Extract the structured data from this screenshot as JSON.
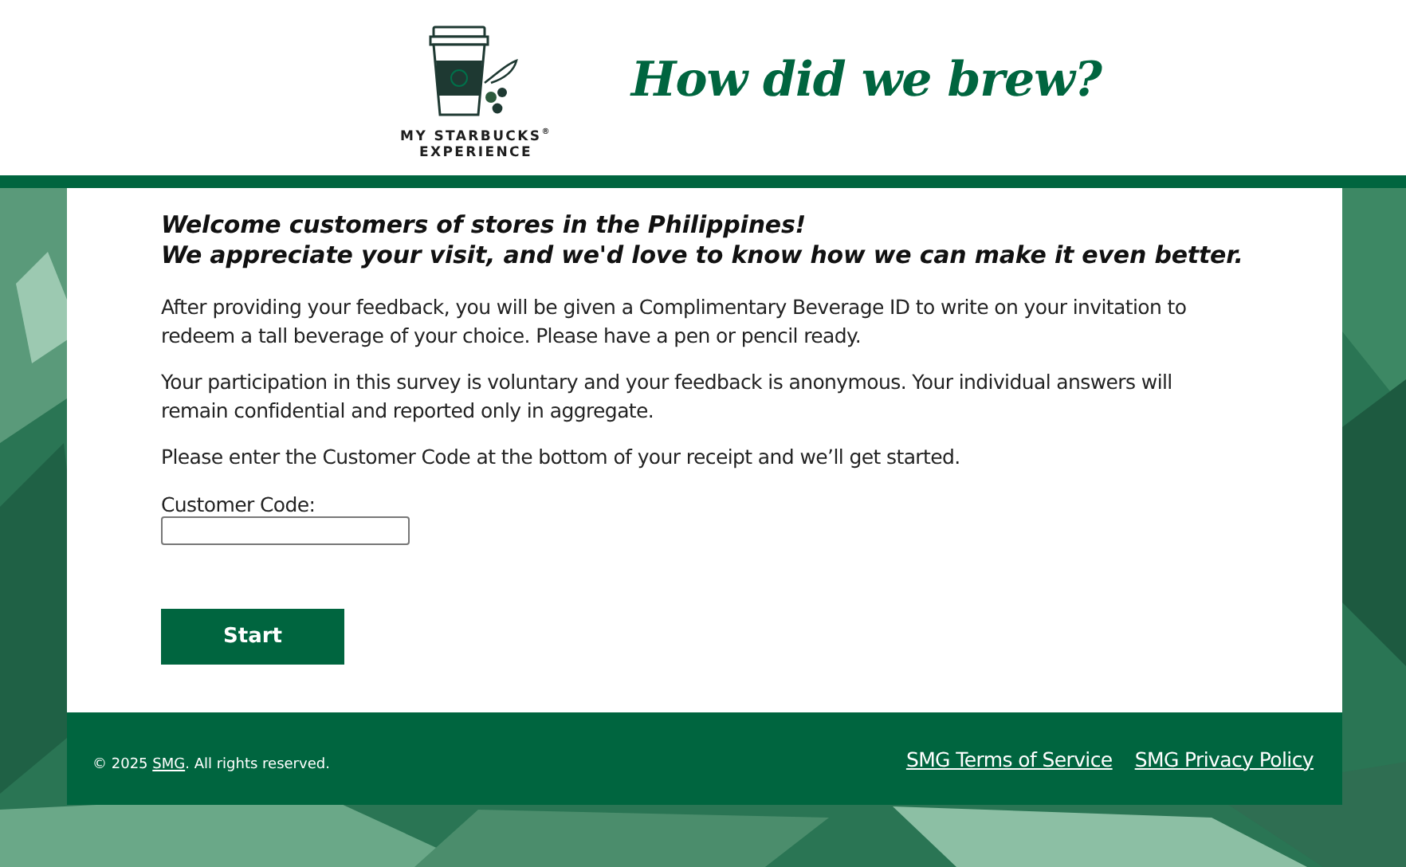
{
  "header": {
    "logo_line_1": "MY STARBUCKS",
    "logo_mark": "®",
    "logo_line_2": "EXPERIENCE",
    "title": "How did we brew?"
  },
  "intro": {
    "heading_lines": [
      "Welcome customers of stores in the Philippines!",
      "We appreciate your visit, and we'd love to know how we can make it even better."
    ],
    "paragraphs": [
      "After providing your feedback, you will be given a Complimentary Beverage ID to write on your invitation to redeem a tall beverage of your choice. Please have a pen or pencil ready.",
      "Your participation in this survey is voluntary and your feedback is anonymous. Your individual answers will remain confidential and reported only in aggregate.",
      "Please enter the Customer Code at the bottom of your receipt and we’ll get started."
    ]
  },
  "form": {
    "label": "Customer Code:",
    "button": "Start"
  },
  "footer": {
    "copyright_prefix": "© 2025",
    "copyright_link": "SMG",
    "copyright_suffix": ". All rights reserved.",
    "links": [
      "SMG Terms of Service",
      "SMG Privacy Policy"
    ]
  }
}
